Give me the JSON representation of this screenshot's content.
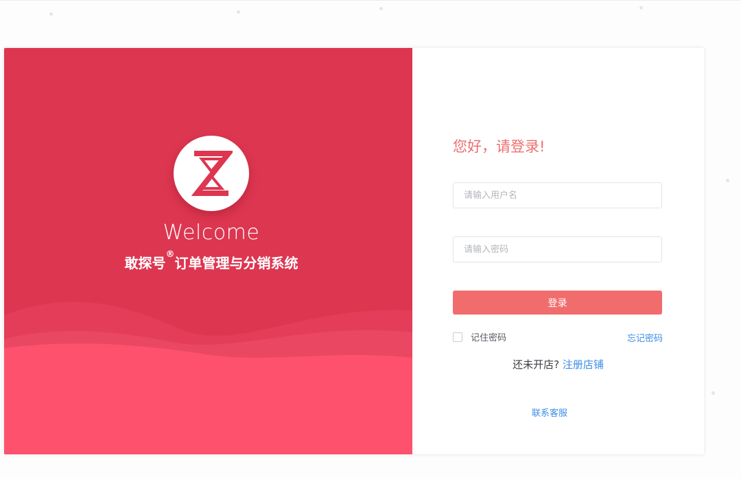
{
  "left": {
    "welcome": "Welcome",
    "brand": "敢探号",
    "registered": "®",
    "product": "订单管理与分销系统"
  },
  "login": {
    "greeting": "您好，请登录!",
    "username_placeholder": "请输入用户名",
    "password_placeholder": "请输入密码",
    "login_label": "登录",
    "remember_label": "记住密码",
    "forgot_label": "忘记密码",
    "no_store_text": "还未开店?",
    "register_label": "注册店铺",
    "contact_label": "联系客服"
  },
  "colors": {
    "brand_red": "#dd3650",
    "button_red": "#f16d6d",
    "link_blue": "#3a8ee6"
  }
}
